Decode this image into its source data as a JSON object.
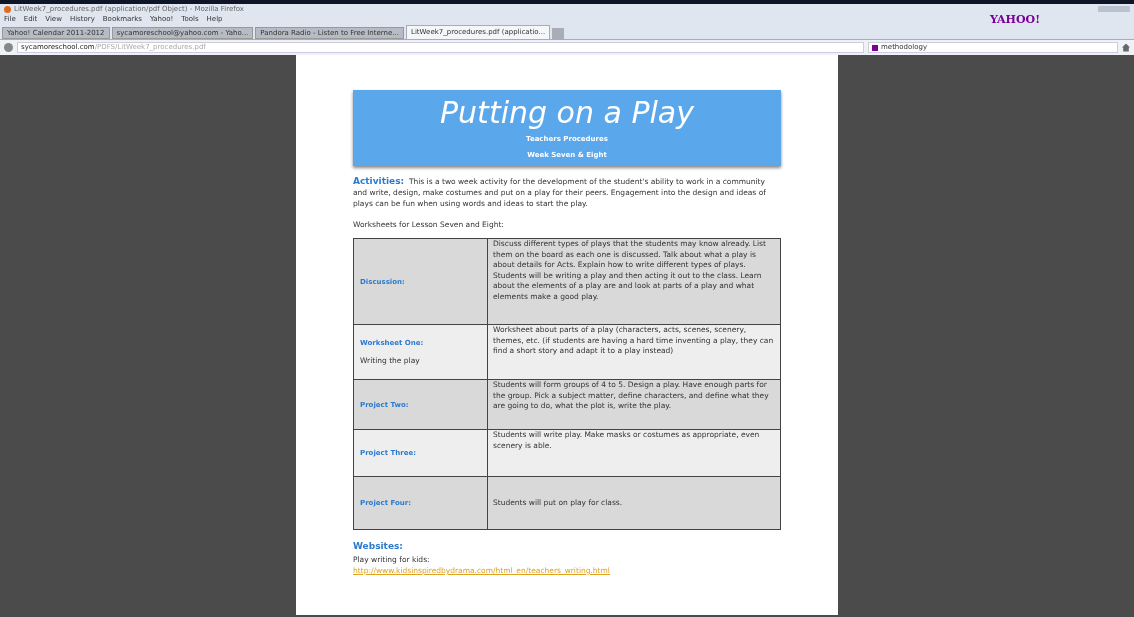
{
  "window": {
    "title": "LitWeek7_procedures.pdf (application/pdf Object) - Mozilla Firefox"
  },
  "menu": [
    "File",
    "Edit",
    "View",
    "History",
    "Bookmarks",
    "Yahoo!",
    "Tools",
    "Help"
  ],
  "brand": "YAHOO!",
  "tabs": [
    {
      "label": "Yahoo! Calendar 2011-2012",
      "selected": false
    },
    {
      "label": "sycamoreschool@yahoo.com - Yaho...",
      "selected": false
    },
    {
      "label": "Pandora Radio - Listen to Free Interne...",
      "selected": false
    },
    {
      "label": "LitWeek7_procedures.pdf (applicatio...",
      "selected": true
    }
  ],
  "address": {
    "host": "sycamoreschool.com",
    "path": "/PDFS/LitWeek7_procedures.pdf"
  },
  "search": {
    "value": "methodology"
  },
  "document": {
    "title": "Putting on a Play",
    "subtitle": "Teachers Procedures",
    "week": "Week Seven & Eight",
    "activities_label": "Activities:",
    "activities_text": "This is a two week activity for the development of the student's ability to work in a community and write, design, make costumes and put on a play for their peers.  Engagement into the design and ideas of plays can be fun when using words and ideas to start the play.",
    "worksheets_heading": "Worksheets for Lesson Seven and Eight:",
    "rows": [
      {
        "label": "Discussion:",
        "note": "",
        "text": "Discuss different types of plays that the students may know already. List them on the board as each one is discussed. Talk about what a play is about details for Acts.  Explain how to write different types of plays. Students will be writing a play and then acting it out to the class. Learn about the elements of a play are and look at parts of a play and what elements make a good play."
      },
      {
        "label": "Worksheet One:",
        "note": "Writing the play",
        "text": "Worksheet about parts of a play (characters, acts, scenes, scenery, themes, etc. (if students are having a hard time inventing a play, they can find a short story and adapt it to a play instead)"
      },
      {
        "label": "Project Two:",
        "note": "",
        "text": "Students will form groups of 4 to 5. Design a play. Have enough parts for the group. Pick a subject matter, define characters, and define what they are going to do, what the plot is, write the play."
      },
      {
        "label": "Project Three:",
        "note": "",
        "text": "Students will write play. Make masks or costumes as appropriate, even scenery is able."
      },
      {
        "label": "Project Four:",
        "note": "",
        "text": "Students will put on play for class."
      }
    ],
    "websites_label": "Websites:",
    "websites_text": "Play writing for kids:",
    "link": "http://www.kidsinspiredbydrama.com/html_en/teachers_writing.html"
  }
}
